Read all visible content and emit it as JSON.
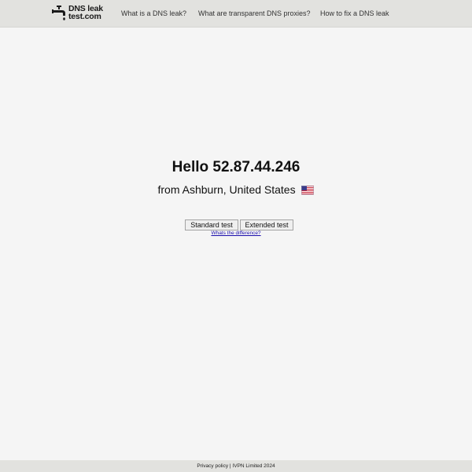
{
  "header": {
    "logo_line1": "DNS leak",
    "logo_line2": "test.com",
    "nav": [
      {
        "label": "What is a DNS leak?"
      },
      {
        "label": "What are transparent DNS proxies?"
      },
      {
        "label": "How to fix a DNS leak"
      }
    ]
  },
  "main": {
    "greeting": "Hello 52.87.44.246",
    "location": "from Ashburn, United States",
    "flag_icon": "us-flag-icon",
    "standard_test_label": "Standard test",
    "extended_test_label": "Extended test",
    "difference_link": "Whats the difference?"
  },
  "footer": {
    "privacy_label": "Privacy policy",
    "separator": "|",
    "company_label": "IVPN Limited 2024"
  }
}
